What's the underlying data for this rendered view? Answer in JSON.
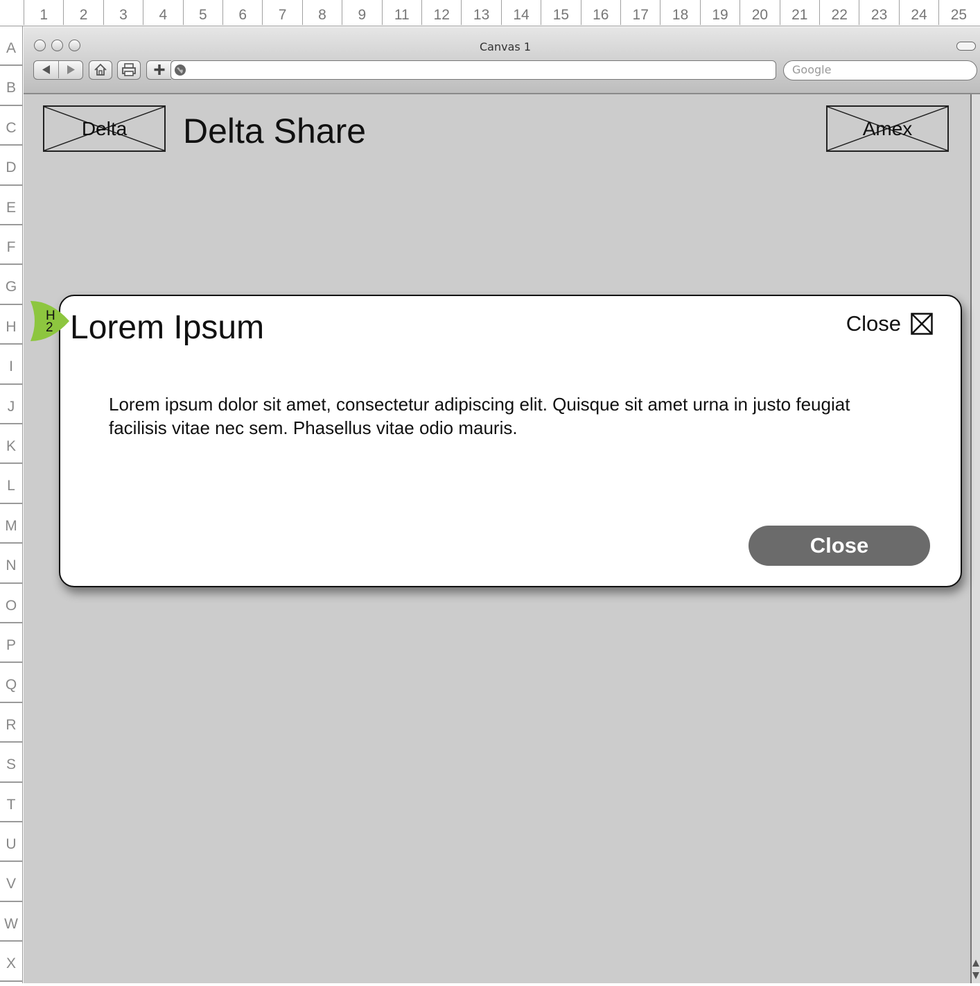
{
  "rulers": {
    "columns": [
      "1",
      "2",
      "3",
      "4",
      "5",
      "6",
      "7",
      "8",
      "9",
      "11",
      "12",
      "13",
      "14",
      "15",
      "16",
      "17",
      "18",
      "19",
      "20",
      "21",
      "22",
      "23",
      "24",
      "25"
    ],
    "rows": [
      "A",
      "B",
      "C",
      "D",
      "E",
      "F",
      "G",
      "H",
      "I",
      "J",
      "K",
      "L",
      "M",
      "N",
      "O",
      "P",
      "Q",
      "R",
      "S",
      "T",
      "U",
      "V",
      "W",
      "X"
    ]
  },
  "browser": {
    "title": "Canvas 1",
    "search_placeholder": "Google",
    "url": ""
  },
  "page": {
    "left_logo": "Delta",
    "site_title": "Delta Share",
    "right_logo": "Amex"
  },
  "modal": {
    "heading_tag": {
      "line1": "H",
      "line2": "2"
    },
    "title": "Lorem Ipsum",
    "close_link": "Close",
    "body": "Lorem ipsum dolor sit amet, consectetur adipiscing elit. Quisque sit amet urna in justo feugiat facilisis vitae nec sem. Phasellus vitae odio mauris.",
    "close_button": "Close"
  },
  "colors": {
    "page_background": "#cccccc",
    "button_fill": "#6b6b6b",
    "heading_tag": "#8dc63f"
  }
}
